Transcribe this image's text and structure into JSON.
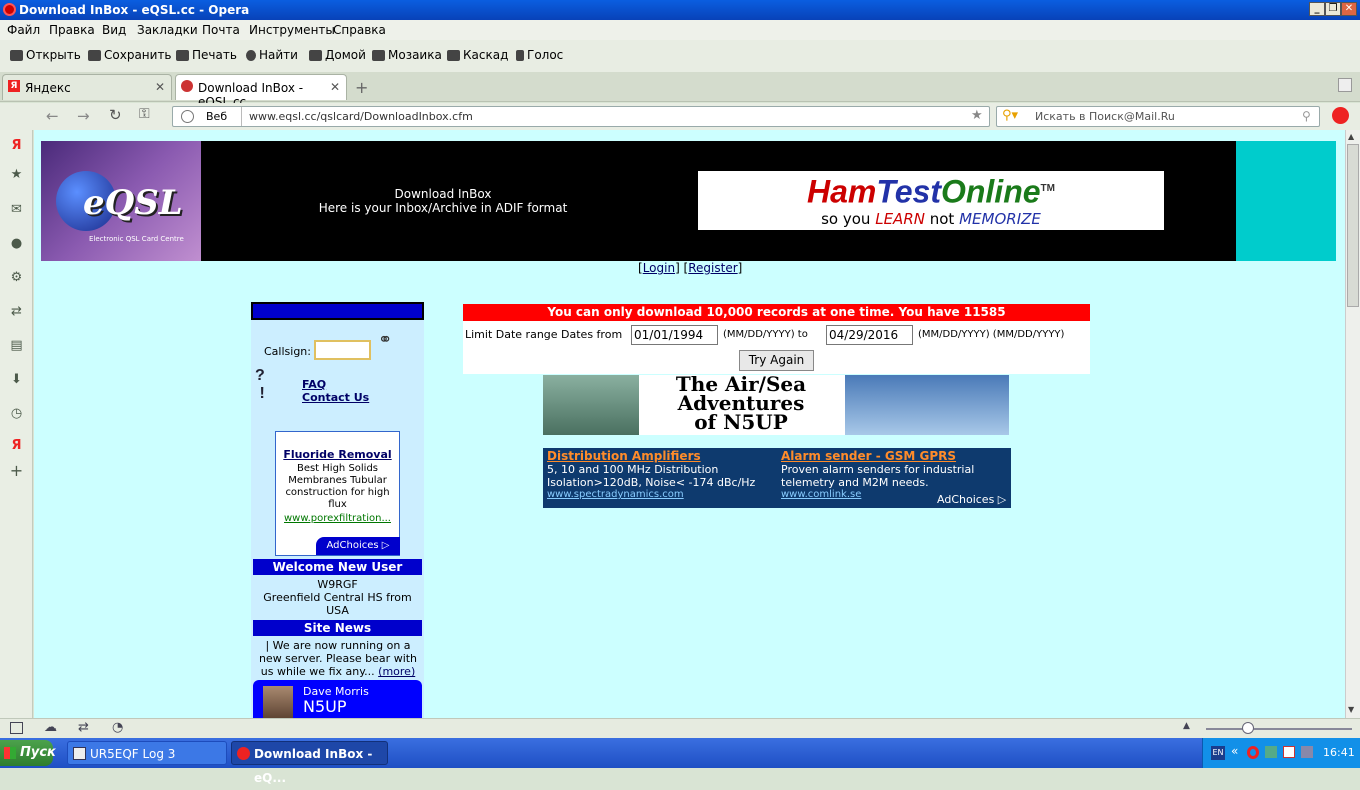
{
  "window": {
    "title": "Download InBox - eQSL.cc - Opera"
  },
  "menu": [
    "Файл",
    "Правка",
    "Вид",
    "Закладки",
    "Почта",
    "Инструменты",
    "Справка"
  ],
  "toolbar": [
    "Открыть",
    "Сохранить",
    "Печать",
    "Найти",
    "Домой",
    "Мозаика",
    "Каскад",
    "Голос"
  ],
  "tabs": [
    {
      "label": "Яндекс"
    },
    {
      "label": "Download InBox - eQSL.cc"
    }
  ],
  "address": {
    "mode": "Веб",
    "url": "www.eqsl.cc/qslcard/DownloadInbox.cfm",
    "search_placeholder": "Искать в Поиск@Mail.Ru"
  },
  "header": {
    "title": "Download InBox",
    "subtitle": "Here is your Inbox/Archive in ADIF format",
    "logo": "eQSL",
    "logo_caption": "Electronic QSL Card Centre",
    "ad_main": "HamTestOnline",
    "ad_tm": "TM",
    "ad_tag_a": "so you",
    "ad_tag_b": "LEARN",
    "ad_tag_c": "not",
    "ad_tag_d": "MEMORIZE"
  },
  "auth": {
    "open": "[",
    "login": "Login",
    "mid": "] [",
    "register": "Register",
    "close": "]"
  },
  "left": {
    "callsign_label": "Callsign:",
    "faq": "FAQ",
    "contact": "Contact Us",
    "ad_title": "Fluoride Removal",
    "ad_body": "Best High Solids Membranes Tubular construction for high flux",
    "ad_url": "www.porexfiltration...",
    "adchoices": "AdChoices",
    "welcome_title": "Welcome New User",
    "welcome_call": "W9RGF",
    "welcome_text": "Greenfield Central HS from USA",
    "news_title": "Site News",
    "news_text": "| We are now running on a new server. Please bear with us while we fix any...",
    "news_more": "(more)",
    "profile_name": "Dave Morris",
    "profile_call": "N5UP"
  },
  "main": {
    "warning": "You can only download 10,000 records at one time. You have 11585",
    "range_label": "Limit Date range Dates from",
    "from": "01/01/1994",
    "fmt1": "(MM/DD/YYYY) to",
    "to": "04/29/2016",
    "fmt2": "(MM/DD/YYYY) (MM/DD/YYYY)",
    "button": "Try Again",
    "banner_line1": "The Air/Sea",
    "banner_line2": "Adventures",
    "banner_line3": "of N5UP",
    "ad1_title": "Distribution Amplifiers",
    "ad1_body": "5, 10 and 100 MHz Distribution Isolation>120dB, Noise< -174 dBc/Hz",
    "ad1_url": "www.spectradynamics.com",
    "ad2_title": "Alarm sender - GSM GPRS",
    "ad2_body": "Proven alarm senders for industrial telemetry and M2M needs.",
    "ad2_url": "www.comlink.se",
    "adchoices": "AdChoices"
  },
  "taskbar": {
    "start": "Пуск",
    "item1": "UR5EQF Log 3",
    "item2": "Download InBox - eQ...",
    "lang": "EN",
    "time": "16:41"
  }
}
